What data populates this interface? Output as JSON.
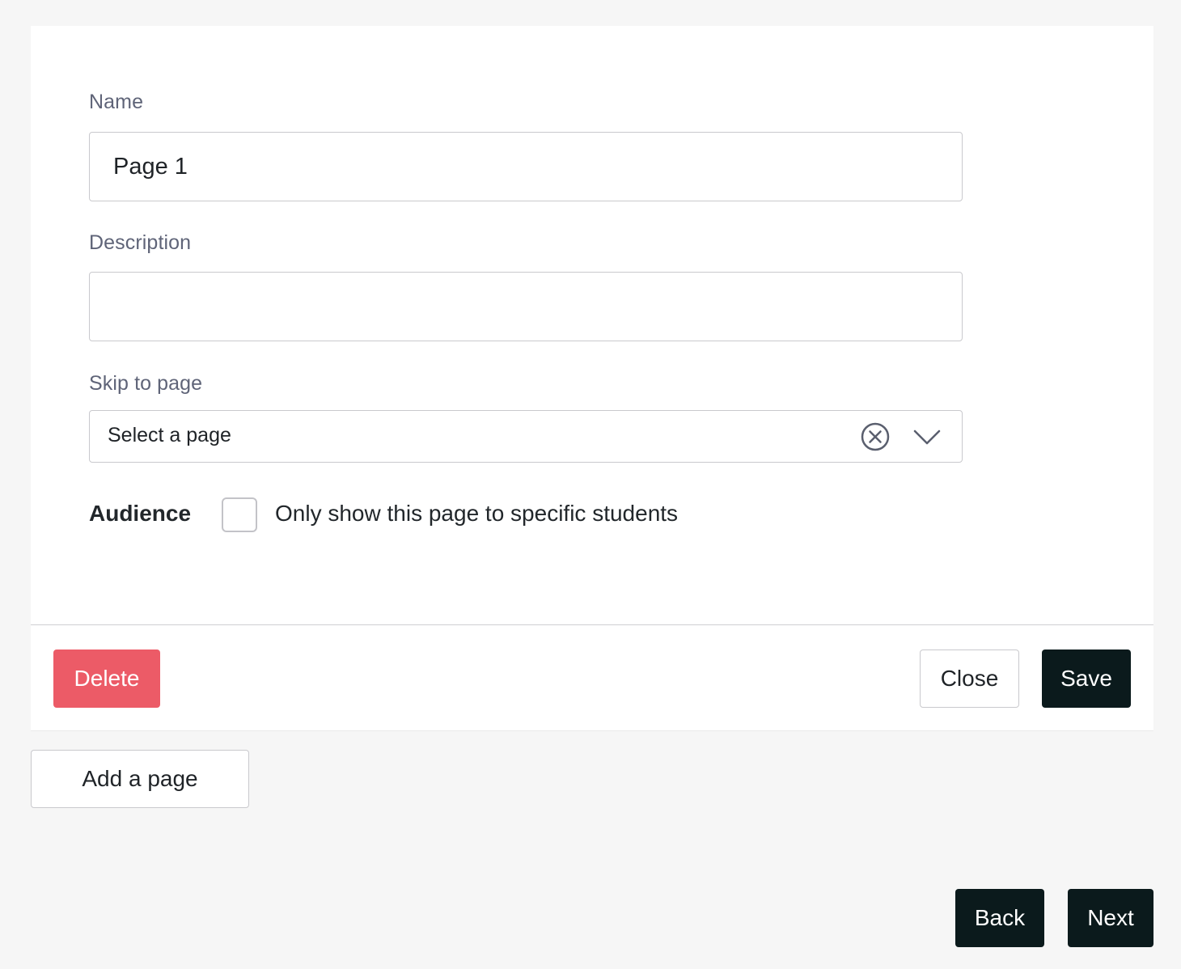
{
  "form": {
    "name": {
      "label": "Name",
      "value": "Page 1"
    },
    "description": {
      "label": "Description",
      "value": ""
    },
    "skip_to_page": {
      "label": "Skip to page",
      "placeholder": "Select a page",
      "clear_icon": "circle-x-icon",
      "dropdown_icon": "chevron-down-icon"
    },
    "audience": {
      "label": "Audience",
      "checkbox_label": "Only show this page to specific students",
      "checked": false
    }
  },
  "panel_actions": {
    "delete_label": "Delete",
    "close_label": "Close",
    "save_label": "Save"
  },
  "add_page_label": "Add a page",
  "navigation": {
    "back_label": "Back",
    "next_label": "Next"
  },
  "colors": {
    "delete": "#ec5b67",
    "primary_dark": "#0b1a1c",
    "label_text": "#5f6478",
    "background": "#f6f6f6"
  }
}
